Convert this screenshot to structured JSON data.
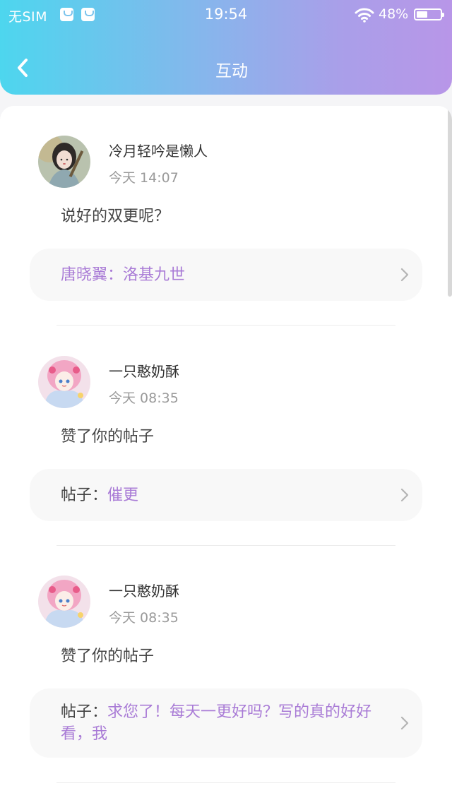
{
  "status_bar": {
    "carrier": "无SIM",
    "time": "19:54",
    "battery": "48%"
  },
  "nav": {
    "title": "互动",
    "back_icon": "chevron-left-icon"
  },
  "colors": {
    "accent": "#a97bd6",
    "header_gradient_start": "#4dd6ee",
    "header_gradient_end": "#b896e8"
  },
  "interactions": [
    {
      "username": "冷月轻吟是懒人",
      "time": "今天 14:07",
      "message": "说好的双更呢？",
      "ref_prefix": "",
      "ref_text": "唐晓翼：洛基九世"
    },
    {
      "username": "一只憨奶酥",
      "time": "今天 08:35",
      "message": "赞了你的帖子",
      "ref_prefix": "帖子：",
      "ref_text": "催更"
    },
    {
      "username": "一只憨奶酥",
      "time": "今天 08:35",
      "message": "赞了你的帖子",
      "ref_prefix": "帖子：",
      "ref_text": "求您了！每天一更好吗？写的真的好好看，我"
    }
  ]
}
